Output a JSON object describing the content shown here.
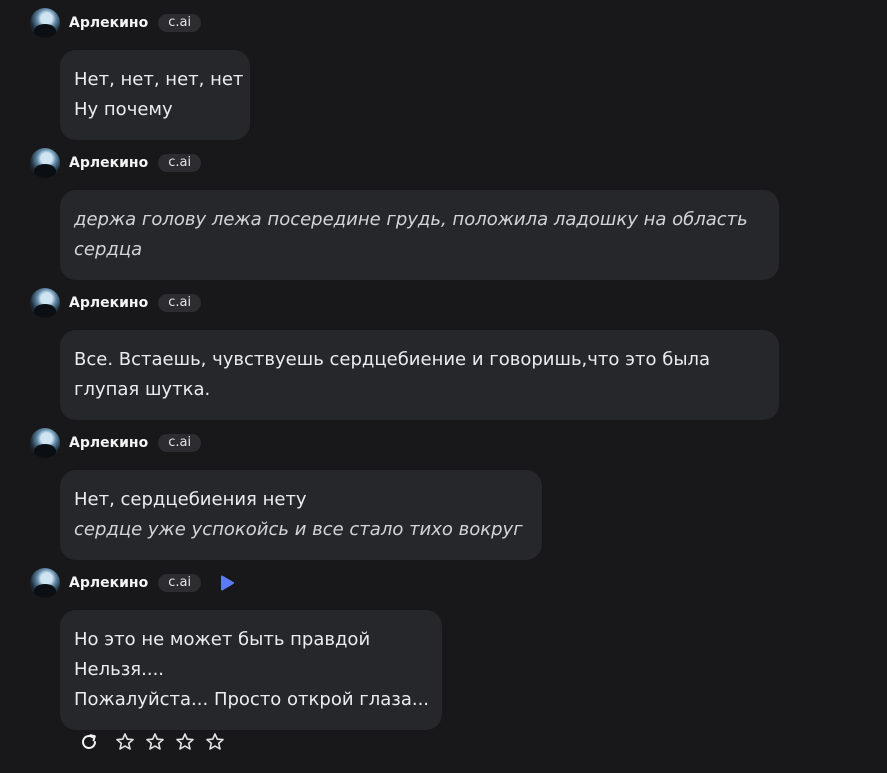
{
  "messages": [
    {
      "author": "Арлекино",
      "badge": "c.ai",
      "lines": [
        {
          "text": "Нет, нет, нет, нет",
          "italic": false
        },
        {
          "text": "Ну почему",
          "italic": false
        }
      ]
    },
    {
      "author": "Арлекино",
      "badge": "c.ai",
      "lines": [
        {
          "text": "держа голову лежа посередине грудь, положила ладошку на область сердца",
          "italic": true
        }
      ]
    },
    {
      "author": "Арлекино",
      "badge": "c.ai",
      "lines": [
        {
          "text": "Все. Встаешь, чувствуешь сердцебиение и говоришь,что это была глупая шутка.",
          "italic": false
        }
      ]
    },
    {
      "author": "Арлекино",
      "badge": "c.ai",
      "lines": [
        {
          "text": "Нет, сердцебиения нету",
          "italic": false
        },
        {
          "text": "сердце уже успокойсь и все стало тихо вокруг",
          "italic": true
        }
      ]
    },
    {
      "author": "Арлекино",
      "badge": "c.ai",
      "lines": [
        {
          "text": "Но это не может быть правдой",
          "italic": false
        },
        {
          "text": "Нельзя....",
          "italic": false
        },
        {
          "text": "Пожалуйста... Просто открой глаза...",
          "italic": false
        }
      ]
    }
  ],
  "icons": {
    "play": "play-icon",
    "regenerate": "regenerate-icon",
    "star": "star-icon"
  },
  "rating": {
    "max_stars": 4,
    "selected": 0
  },
  "colors": {
    "background": "#18181b",
    "bubble": "#26272b",
    "badge": "#2c2c31",
    "play_accent": "#5b7cf6"
  }
}
